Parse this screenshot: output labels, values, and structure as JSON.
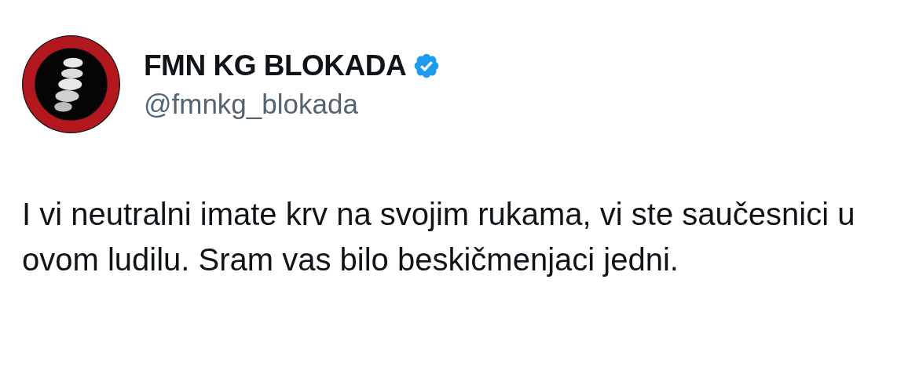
{
  "author": {
    "name": "FMN KG BLOKADA",
    "verified": true,
    "handle": "@fmnkg_blokada"
  },
  "tweet": {
    "text": "I vi neutralni imate krv na svojim rukama, vi ste saučesnici u ovom ludilu. Sram vas bilo beskičmenjaci jedni."
  }
}
